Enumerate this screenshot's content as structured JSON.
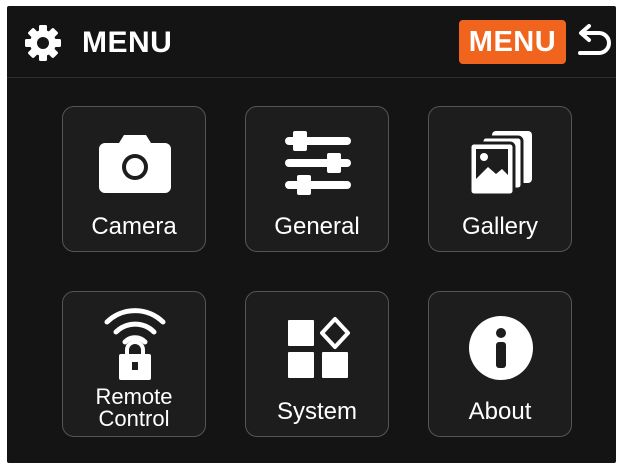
{
  "header": {
    "title": "MENU",
    "menu_badge": "MENU",
    "icons": [
      "gear-icon",
      "back-arrow-icon"
    ]
  },
  "tiles": [
    {
      "label": "Camera",
      "icon": "camera-icon"
    },
    {
      "label": "General",
      "icon": "sliders-icon"
    },
    {
      "label": "Gallery",
      "icon": "gallery-icon"
    },
    {
      "label": "Remote\nControl",
      "icon": "wifi-lock-icon"
    },
    {
      "label": "System",
      "icon": "grid-diamond-icon"
    },
    {
      "label": "About",
      "icon": "info-icon"
    }
  ],
  "colors": {
    "background": "#141414",
    "tile_background": "#1d1d1d",
    "tile_border": "#555555",
    "accent": "#f0641e",
    "text": "#ffffff"
  }
}
